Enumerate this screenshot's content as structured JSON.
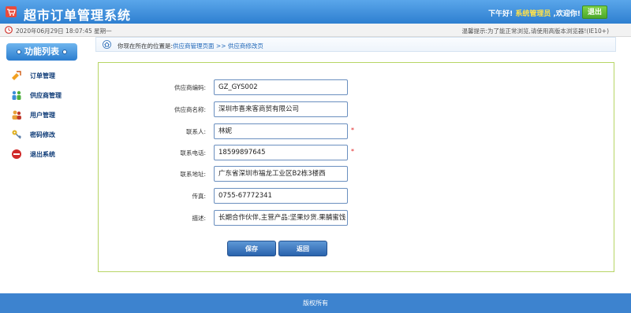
{
  "header": {
    "app_title": "超市订单管理系统",
    "greeting_prefix": "下午好!",
    "user_role": "系统管理员",
    "greeting_suffix": ",欢迎你!",
    "logout_label": "退出"
  },
  "subbar": {
    "datetime": "2020年06月29日 18:07:45 星期一",
    "notice": "温馨提示:为了能正常浏览,请使用高版本浏览器!(IE10+)"
  },
  "sidebar": {
    "title": "功能列表",
    "items": [
      {
        "label": "订单管理",
        "icon": "order-icon"
      },
      {
        "label": "供应商管理",
        "icon": "provider-icon"
      },
      {
        "label": "用户管理",
        "icon": "users-icon"
      },
      {
        "label": "密码修改",
        "icon": "key-icon"
      },
      {
        "label": "退出系统",
        "icon": "exit-icon"
      }
    ]
  },
  "breadcrumb": {
    "prefix": "你现在所在的位置是:",
    "link1": "供应商管理页面",
    "separator": " >> ",
    "link2": "供应商修改页"
  },
  "form": {
    "fields": [
      {
        "label": "供应商编码:",
        "value": "GZ_GYS002",
        "required": false
      },
      {
        "label": "供应商名称:",
        "value": "深圳市喜来客商贸有限公司",
        "required": false
      },
      {
        "label": "联系人:",
        "value": "林妮",
        "required": true
      },
      {
        "label": "联系电话:",
        "value": "18599897645",
        "required": true
      },
      {
        "label": "联系地址:",
        "value": "广东省深圳市福龙工业区B2栋3楼西",
        "required": false
      },
      {
        "label": "传真:",
        "value": "0755-67772341",
        "required": false
      },
      {
        "label": "描述:",
        "value": "长期合作伙伴,主营产品:坚果炒货.果脯蜜饯",
        "required": false
      }
    ],
    "required_mark": "*",
    "save_label": "保存",
    "back_label": "返回"
  },
  "footer": {
    "text": "版权所有"
  },
  "colors": {
    "header_blue": "#2e7fd0",
    "accent_green": "#4ca82a",
    "frame_green": "#b7d565",
    "required_red": "#e02020",
    "link_blue": "#1f66b8"
  }
}
